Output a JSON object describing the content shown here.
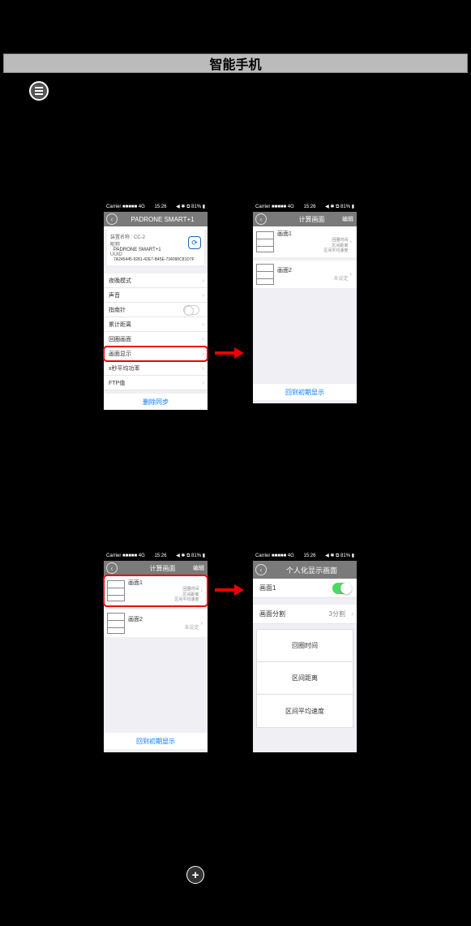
{
  "header": {
    "tab": "智能手机"
  },
  "status": {
    "left": "Carrier ■■■■■ 4G",
    "time": "15:26",
    "right": "◀ ✱ ⧉ 81% ▮"
  },
  "phone1": {
    "title": "PADRONE SMART+1",
    "info": {
      "name_label": "装置名称 : CC-2",
      "nick_label": "昵称",
      "nick_value": "PADRONE SMART+1",
      "uuid_label": "UUID",
      "uuid_value": "7A245445-9281-42E7-B45E-734090C81D7F"
    },
    "rows": {
      "night": "夜晚模式",
      "sound": "声音",
      "compass": "指南针",
      "totaldist": "累计距离",
      "lap": "回圈画面",
      "display": "画面显示",
      "power": "x秒平均功率",
      "ftp": "FTP值"
    },
    "footer": "删除同步"
  },
  "phone2": {
    "title": "计算画面",
    "edit": "编辑",
    "screen1": {
      "title": "画面1",
      "sub1": "回圈时间",
      "sub2": "区间距离",
      "sub3": "区间平均速度"
    },
    "screen2": {
      "title": "画面2",
      "unset": "未设定"
    },
    "footer": "回到初期显示"
  },
  "phone3": {
    "title": "计算画面",
    "edit": "编辑",
    "screen1": {
      "title": "画面1",
      "sub1": "回圈时间",
      "sub2": "区间距离",
      "sub3": "区间平均速度"
    },
    "screen2": {
      "title": "画面2",
      "unset": "未设定"
    },
    "footer": "回到初期显示"
  },
  "phone4": {
    "title": "个人化显示画面",
    "screen_label": "画面1",
    "split_label": "画面分割",
    "split_value": "3分割",
    "seg1": "回圈时间",
    "seg2": "区间距离",
    "seg3": "区间平均速度"
  }
}
